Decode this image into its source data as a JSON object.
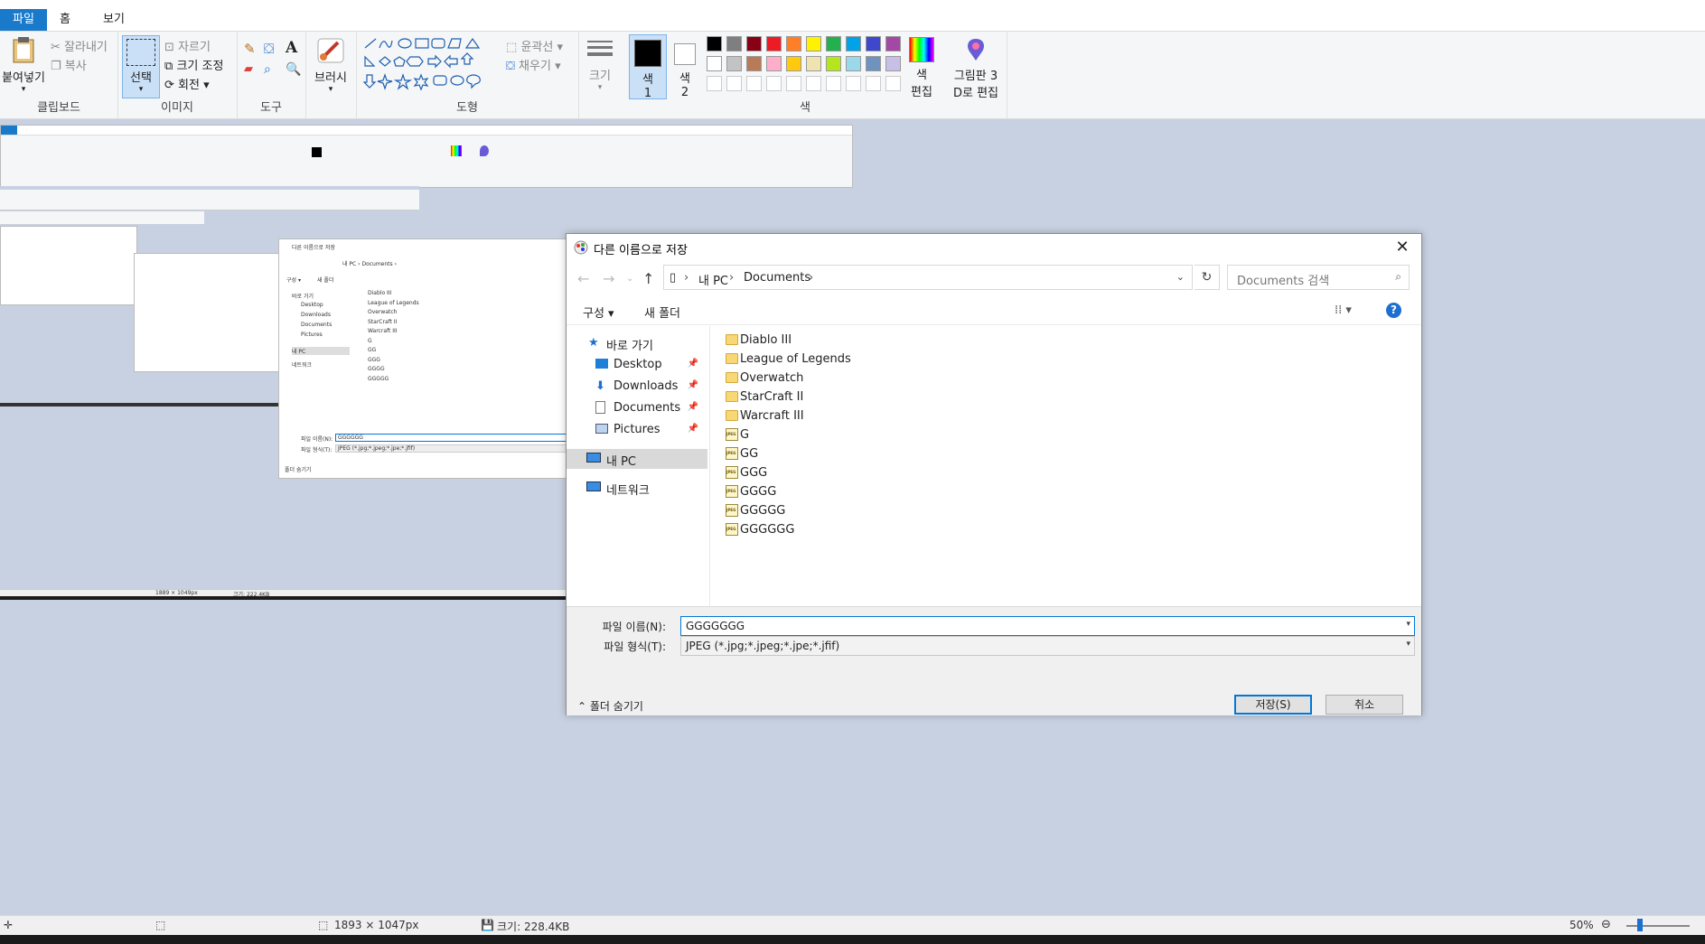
{
  "paint": {
    "tabs": [
      "파일",
      "홈",
      "보기"
    ],
    "clipboard": {
      "paste": "붙여넣기",
      "cut": "잘라내기",
      "copy": "복사",
      "label": "클립보드"
    },
    "image": {
      "select": "선택",
      "crop": "자르기",
      "resize": "크기 조정",
      "rotate": "회전",
      "label": "이미지"
    },
    "tools": {
      "label": "도구"
    },
    "brushes": "브러시",
    "shapes": {
      "outline": "윤곽선",
      "fill": "채우기",
      "label": "도형"
    },
    "size": "크기",
    "color1": [
      "색",
      "1"
    ],
    "color2": [
      "색",
      "2"
    ],
    "colors_label": "색",
    "edit_colors": [
      "색",
      "편집"
    ],
    "paint3d": [
      "그림판 3",
      "D로 편집"
    ],
    "palette": [
      "#000000",
      "#7f7f7f",
      "#880015",
      "#ed1c24",
      "#ff7f27",
      "#fff200",
      "#22b14c",
      "#00a2e8",
      "#3f48cc",
      "#a349a4",
      "#ffffff",
      "#c3c3c3",
      "#b97a57",
      "#ffaec9",
      "#ffc90e",
      "#efe4b0",
      "#b5e61d",
      "#99d9ea",
      "#7092be",
      "#c8bfe7"
    ]
  },
  "nested": {
    "files": [
      "Diablo III",
      "League of Legends",
      "Overwatch",
      "StarCraft II",
      "Warcraft III",
      "G",
      "GG",
      "GGG",
      "GGGG",
      "GGGGG"
    ],
    "dialog_title": "다른 이름으로 저장",
    "crumb": "내 PC › Documents ›",
    "org": "구성 ▾",
    "newfolder": "새 폴더",
    "nav": [
      "바로 가기",
      "Desktop",
      "Downloads",
      "Documents",
      "Pictures",
      "내 PC",
      "네트워크"
    ],
    "filename_label": "파일 이름(N):",
    "filename": "GGGGGG",
    "filetype_label": "파일 형식(T):",
    "filetype": "JPEG (*.jpg;*.jpeg;*.jpe;*.jfif)",
    "hide": "폴더 숨기기",
    "status_dims": "1889 × 1049px",
    "status_size": "크기: 222.4KB"
  },
  "dialog": {
    "title": "다른 이름으로 저장",
    "close": "✕",
    "address": [
      "내 PC",
      "Documents"
    ],
    "search_placeholder": "Documents 검색",
    "organize": "구성 ▾",
    "new_folder": "새 폴더",
    "view": "⁞⁞ ▾",
    "help": "?",
    "nav": [
      {
        "label": "바로 가기",
        "pinned": false
      },
      {
        "label": "Desktop",
        "pinned": true
      },
      {
        "label": "Downloads",
        "pinned": true
      },
      {
        "label": "Documents",
        "pinned": true
      },
      {
        "label": "Pictures",
        "pinned": true
      },
      {
        "label": "내 PC",
        "pinned": false
      },
      {
        "label": "네트워크",
        "pinned": false
      }
    ],
    "folders": [
      "Diablo III",
      "League of Legends",
      "Overwatch",
      "StarCraft II",
      "Warcraft III"
    ],
    "files": [
      "G",
      "GG",
      "GGG",
      "GGGG",
      "GGGGG",
      "GGGGGG"
    ],
    "filename_label": "파일 이름(N):",
    "filename_value": "GGGGGGG",
    "filetype_label": "파일 형식(T):",
    "filetype_value": "JPEG (*.jpg;*.jpeg;*.jpe;*.jfif)",
    "hide_folders": "폴더 숨기기",
    "save": "저장(S)",
    "cancel": "취소"
  },
  "status": {
    "dims": "1893 × 1047px",
    "size": "크기: 228.4KB",
    "zoom": "50%"
  }
}
